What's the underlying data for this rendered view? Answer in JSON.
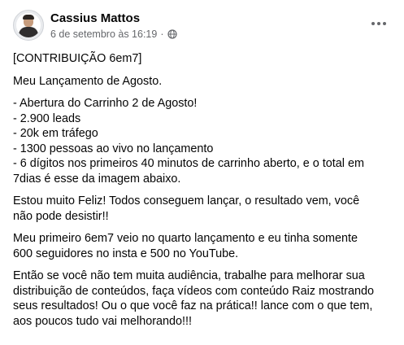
{
  "post": {
    "author": "Cassius Mattos",
    "date": "6 de setembro às 16:19",
    "separator": "·",
    "privacy_icon": "globe-icon",
    "more_icon": "more-horizontal-icon",
    "paragraphs": [
      [
        "[CONTRIBUIÇÃO 6em7]"
      ],
      [
        "Meu Lançamento de Agosto."
      ],
      [
        "- Abertura do Carrinho 2 de Agosto!",
        "- 2.900 leads",
        "- 20k em tráfego",
        "- 1300 pessoas ao vivo no lançamento",
        "-  6 dígitos nos primeiros 40 minutos de carrinho aberto, e o total em",
        "7dias é esse da imagem abaixo."
      ],
      [
        "Estou muito Feliz! Todos conseguem lançar,  o resultado vem, você",
        "não pode desistir!!"
      ],
      [
        "Meu primeiro 6em7 veio no quarto lançamento e eu tinha somente",
        "600 seguidores no insta e 500 no YouTube."
      ],
      [
        "Então se você não tem muita audiência, trabalhe para melhorar sua",
        "distribuição de conteúdos, faça vídeos com conteúdo Raiz mostrando",
        "seus resultados! Ou o que você faz na prática!! lance com o que tem,",
        "aos poucos tudo vai melhorando!!!"
      ]
    ]
  }
}
